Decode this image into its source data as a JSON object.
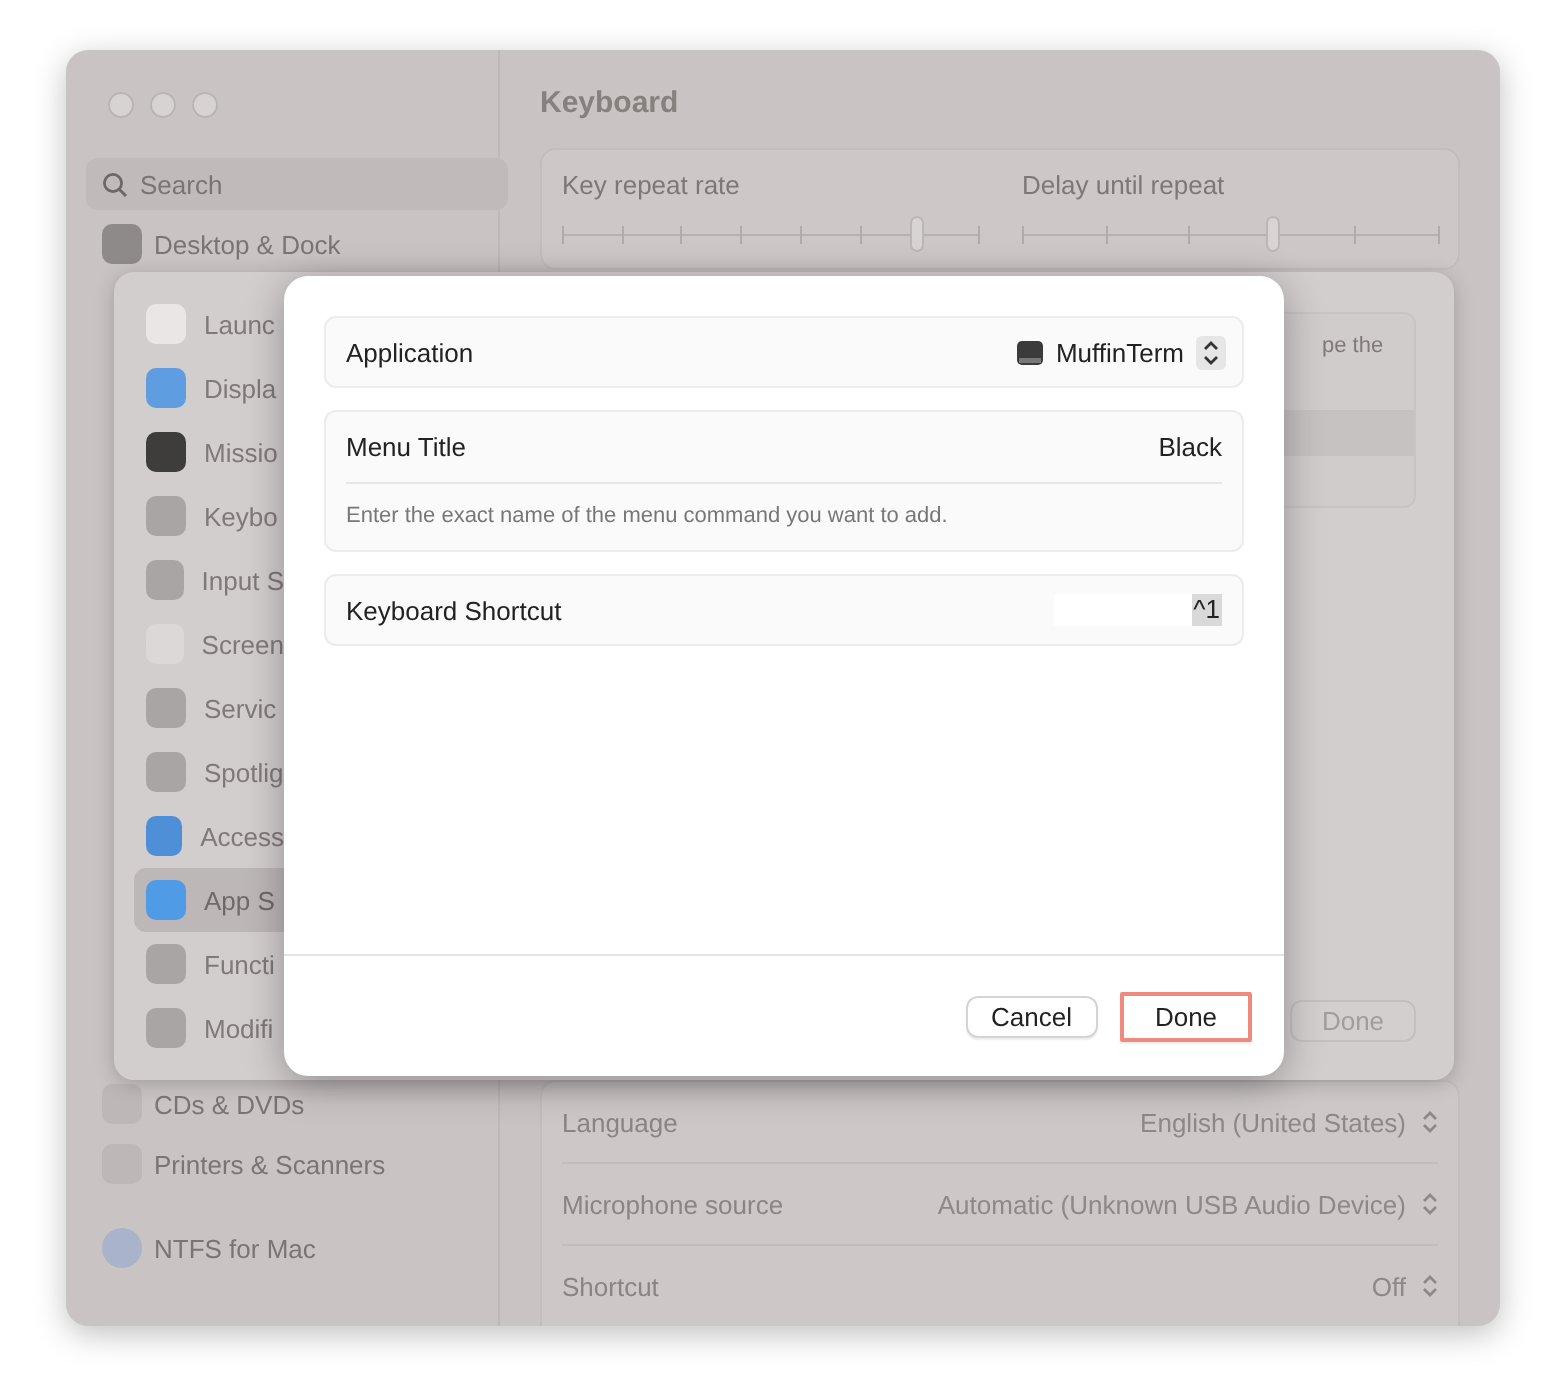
{
  "window": {
    "title": "Keyboard"
  },
  "sidebar": {
    "search": {
      "placeholder": "Search"
    },
    "items_top": [
      {
        "label": "Desktop & Dock",
        "color": "#8e8a89"
      }
    ],
    "items_bottom": [
      {
        "label": "CDs & DVDs",
        "color": "#bdb8b7"
      },
      {
        "label": "Printers & Scanners",
        "color": "#bdb8b7"
      }
    ],
    "footer_item": {
      "label": "NTFS for Mac",
      "color": "#a9b3c9"
    }
  },
  "sliders": [
    {
      "label": "Key repeat rate",
      "level": 0.85
    },
    {
      "label": "Delay until repeat",
      "level": 0.6
    }
  ],
  "settings": [
    {
      "label": "Language",
      "value": "English (United States)"
    },
    {
      "label": "Microphone source",
      "value": "Automatic (Unknown USB Audio Device)"
    },
    {
      "label": "Shortcut",
      "value": "Off"
    }
  ],
  "sheet": {
    "items": [
      {
        "label": "Launc",
        "color": "#e9e6e5",
        "selected": false
      },
      {
        "label": "Displa",
        "color": "#5e9ee0",
        "selected": false
      },
      {
        "label": "Missio",
        "color": "#3f3c3c",
        "selected": false
      },
      {
        "label": "Keybo",
        "color": "#a9a5a4",
        "selected": false
      },
      {
        "label": "Input S",
        "color": "#a9a5a4",
        "selected": false
      },
      {
        "label": "Screen",
        "color": "#dcd8d7",
        "selected": false
      },
      {
        "label": "Servic",
        "color": "#a9a5a4",
        "selected": false
      },
      {
        "label": "Spotlig",
        "color": "#a9a5a4",
        "selected": false
      },
      {
        "label": "Access",
        "color": "#4e8fd8",
        "selected": false
      },
      {
        "label": "App S",
        "color": "#4f9be6",
        "selected": true
      },
      {
        "label": "Functi",
        "color": "#a9a5a4",
        "selected": false
      },
      {
        "label": "Modifi",
        "color": "#a9a5a4",
        "selected": false
      }
    ],
    "hint_fragment": "pe the",
    "done": "Done"
  },
  "dialog": {
    "application": {
      "label": "Application",
      "value": "MuffinTerm"
    },
    "menu_title": {
      "label": "Menu Title",
      "value": "Black",
      "hint": "Enter the exact name of the menu command you want to add."
    },
    "shortcut": {
      "label": "Keyboard Shortcut",
      "value": "^1"
    },
    "buttons": [
      {
        "label": "Cancel",
        "focused": false
      },
      {
        "label": "Done",
        "focused": true
      }
    ]
  }
}
